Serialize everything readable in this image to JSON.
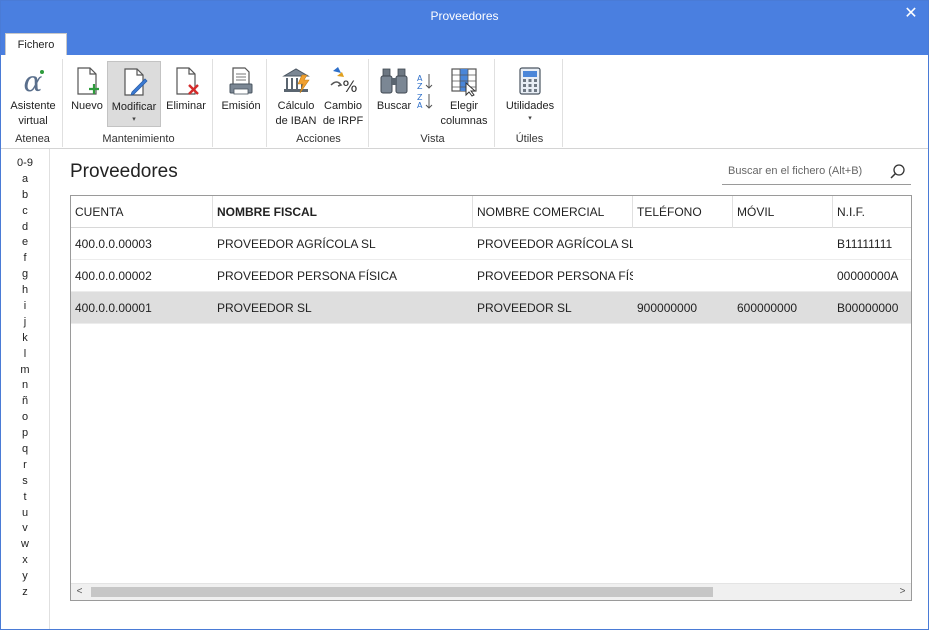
{
  "window": {
    "title": "Proveedores",
    "close_glyph": "✕"
  },
  "tabs": [
    {
      "label": "Fichero"
    }
  ],
  "ribbon": {
    "groups": {
      "atenea": {
        "label": "Atenea",
        "buttons": {
          "asistente": "Asistente\nvirtual"
        }
      },
      "mantenimiento": {
        "label": "Mantenimiento",
        "buttons": {
          "nuevo": "Nuevo",
          "modificar": "Modificar",
          "eliminar": "Eliminar"
        }
      },
      "emision": {
        "label": "",
        "buttons": {
          "emision": "Emisión"
        }
      },
      "acciones": {
        "label": "Acciones",
        "buttons": {
          "iban": "Cálculo\nde IBAN",
          "irpf": "Cambio\nde IRPF"
        }
      },
      "vista": {
        "label": "Vista",
        "buttons": {
          "buscar": "Buscar",
          "elegir": "Elegir\ncolumnas"
        }
      },
      "utiles": {
        "label": "Útiles",
        "buttons": {
          "utilidades": "Utilidades"
        }
      }
    },
    "dropdown_glyph": "▾"
  },
  "alphabet": [
    "0-9",
    "a",
    "b",
    "c",
    "d",
    "e",
    "f",
    "g",
    "h",
    "i",
    "j",
    "k",
    "l",
    "m",
    "n",
    "ñ",
    "o",
    "p",
    "q",
    "r",
    "s",
    "t",
    "u",
    "v",
    "w",
    "x",
    "y",
    "z"
  ],
  "page_title": "Proveedores",
  "search": {
    "placeholder": "Buscar en el fichero (Alt+B)"
  },
  "table": {
    "columns": [
      "CUENTA",
      "NOMBRE FISCAL",
      "NOMBRE COMERCIAL",
      "TELÉFONO",
      "MÓVIL",
      "N.I.F."
    ],
    "sorted_column": "NOMBRE FISCAL",
    "rows": [
      [
        "400.0.0.00003",
        "PROVEEDOR AGRÍCOLA SL",
        "PROVEEDOR AGRÍCOLA SL",
        "",
        "",
        "B11111111"
      ],
      [
        "400.0.0.00002",
        "PROVEEDOR PERSONA FÍSICA",
        "PROVEEDOR PERSONA FÍSI...",
        "",
        "",
        "00000000A"
      ],
      [
        "400.0.0.00001",
        "PROVEEDOR SL",
        "PROVEEDOR SL",
        "900000000",
        "600000000",
        "B00000000"
      ]
    ],
    "selected_row": 2
  },
  "scrollbar": {
    "left_glyph": "<",
    "right_glyph": ">"
  },
  "colors": {
    "titlebar": "#4a7fe0",
    "accent_green": "#2e9b3c",
    "accent_red": "#d42b2b",
    "selected_row": "#dedede"
  }
}
